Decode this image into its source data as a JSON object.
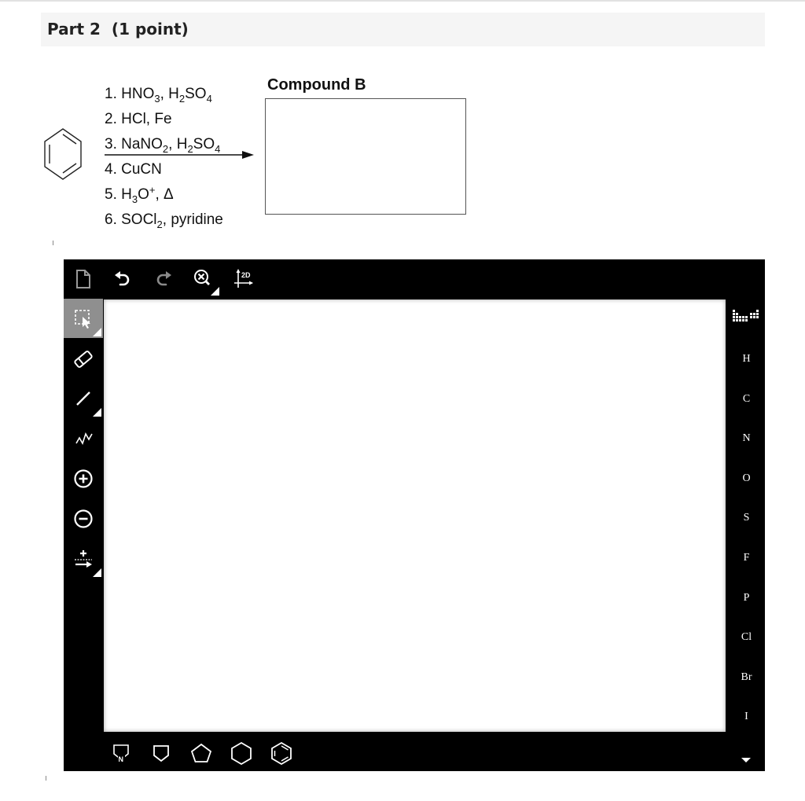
{
  "header": {
    "part": "Part 2",
    "points": "(1 point)"
  },
  "reaction": {
    "steps": [
      {
        "num": "1.",
        "parts": [
          [
            "HNO",
            ""
          ],
          [
            "3",
            "sub"
          ],
          [
            ", H",
            ""
          ],
          [
            "2",
            "sub"
          ],
          [
            "SO",
            ""
          ],
          [
            "4",
            "sub"
          ]
        ]
      },
      {
        "num": "2.",
        "parts": [
          [
            "HCl, Fe",
            ""
          ]
        ]
      },
      {
        "num": "3.",
        "parts": [
          [
            "NaNO",
            ""
          ],
          [
            "2",
            "sub"
          ],
          [
            ", H",
            ""
          ],
          [
            "2",
            "sub"
          ],
          [
            "SO",
            ""
          ],
          [
            "4",
            "sub"
          ]
        ]
      },
      {
        "num": "4.",
        "parts": [
          [
            "CuCN",
            ""
          ]
        ]
      },
      {
        "num": "5.",
        "parts": [
          [
            "H",
            ""
          ],
          [
            "3",
            "sub"
          ],
          [
            "O",
            ""
          ],
          [
            "+",
            "sup"
          ],
          [
            ", Δ",
            ""
          ]
        ]
      },
      {
        "num": "6.",
        "parts": [
          [
            "SOCl",
            ""
          ],
          [
            "2",
            "sub"
          ],
          [
            ", pyridine",
            ""
          ]
        ]
      }
    ],
    "compound_label": "Compound B"
  },
  "editor": {
    "top_tools": [
      "new-document-icon",
      "undo-icon",
      "redo-icon",
      "zoom-clear-icon",
      "clean-2d-icon"
    ],
    "clean_label": "2D",
    "left_tools": [
      "select-icon",
      "eraser-icon",
      "single-bond-icon",
      "chain-icon",
      "positive-charge-icon",
      "negative-charge-icon",
      "reaction-arrow-icon"
    ],
    "atoms": [
      "H",
      "C",
      "N",
      "O",
      "S",
      "F",
      "P",
      "Cl",
      "Br",
      "I"
    ],
    "templates": [
      "pyrrole-template",
      "cyclobutane-template",
      "cyclopentane-template",
      "cyclohexane-template",
      "benzene-template"
    ],
    "pyrrole_atom": "N"
  }
}
